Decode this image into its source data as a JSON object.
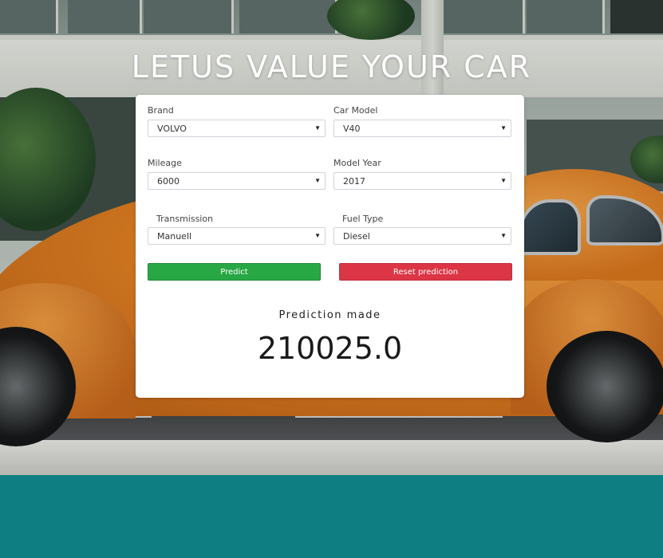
{
  "header": {
    "title": "LETUS VALUE YOUR CAR"
  },
  "form": {
    "brand": {
      "label": "Brand",
      "value": "VOLVO"
    },
    "car_model": {
      "label": "Car Model",
      "value": "V40"
    },
    "mileage": {
      "label": "Mileage",
      "value": "6000"
    },
    "model_year": {
      "label": "Model Year",
      "value": "2017"
    },
    "transmission": {
      "label": "Transmission",
      "value": "Manuell"
    },
    "fuel_type": {
      "label": "Fuel Type",
      "value": "Diesel"
    }
  },
  "buttons": {
    "predict_label": "Predict",
    "reset_label": "Reset prediction"
  },
  "result": {
    "label": "Prediction made",
    "value": "210025.0"
  },
  "colors": {
    "predict": "#28a745",
    "reset": "#dc3545",
    "footer": "#0e7e83"
  },
  "icons": {
    "dropdown": "caret-down-icon"
  }
}
